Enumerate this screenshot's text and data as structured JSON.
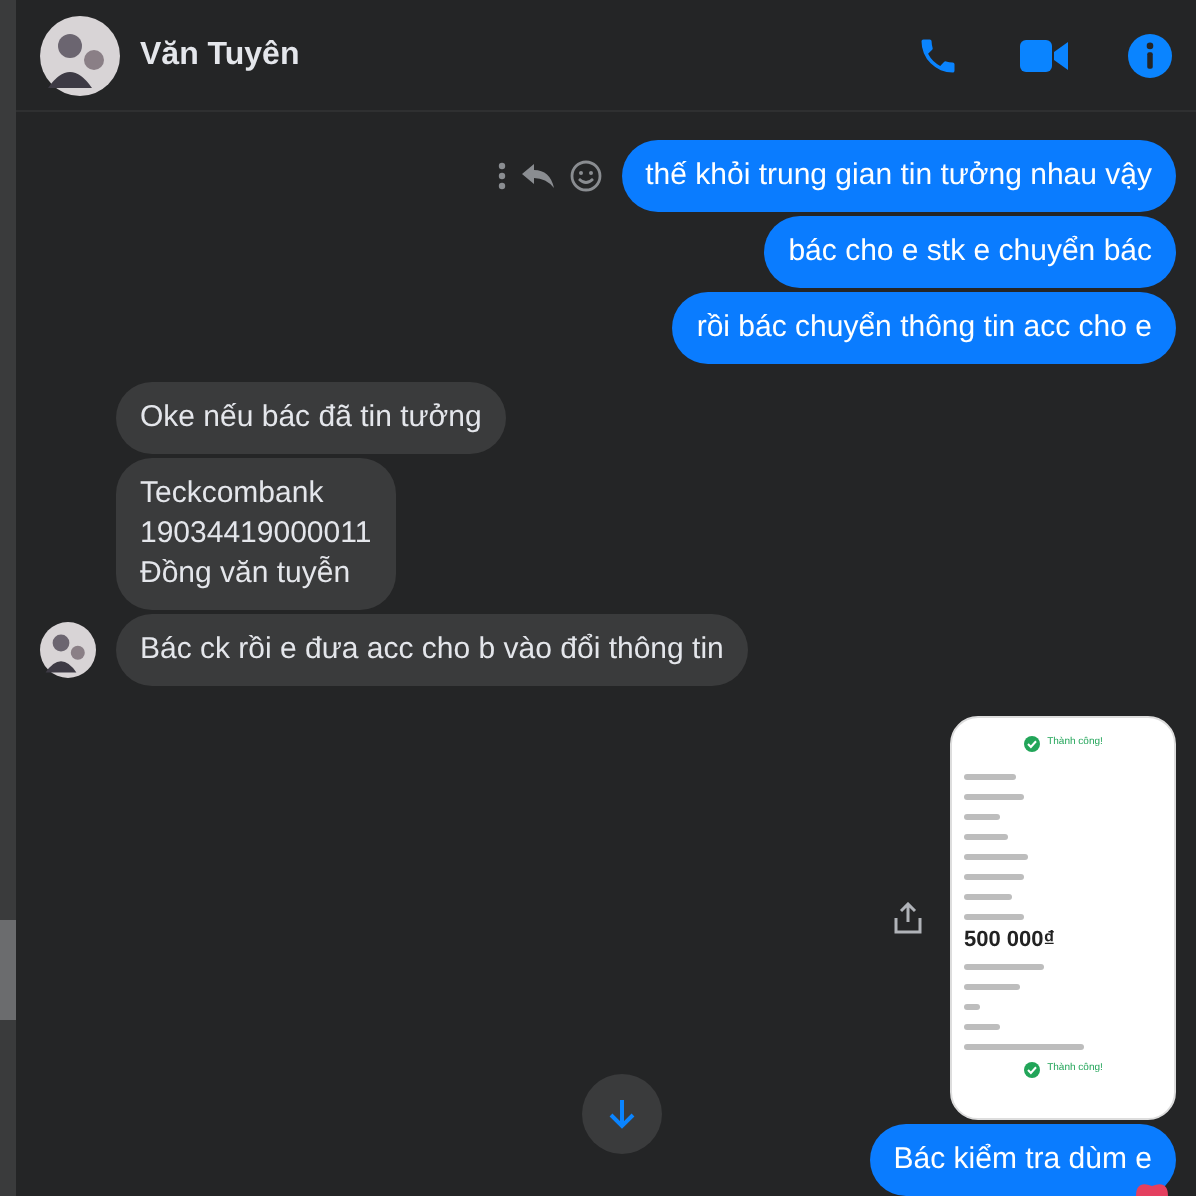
{
  "header": {
    "name": "Văn Tuyên"
  },
  "messages": [
    {
      "kind": "text",
      "outgoing": true,
      "text": "thế khỏi trung gian tin tưởng nhau vậy",
      "actions": true
    },
    {
      "kind": "text",
      "outgoing": true,
      "text": "bác cho e stk e chuyển bác"
    },
    {
      "kind": "text",
      "outgoing": true,
      "text": "rồi bác chuyển thông tin acc cho e"
    },
    {
      "kind": "text",
      "outgoing": false,
      "text": "Oke nếu bác đã tin tưởng"
    },
    {
      "kind": "text",
      "outgoing": false,
      "lines": [
        "Teckcombank",
        "19034419000011",
        "Đồng văn tuyễn"
      ]
    },
    {
      "kind": "text",
      "outgoing": false,
      "text": "Bác ck rồi e đưa acc cho b vào đổi thông tin",
      "avatar": true
    },
    {
      "kind": "image",
      "outgoing": true,
      "status": "Thành công!",
      "amount": "500 000₫",
      "footer": "Thành công!"
    },
    {
      "kind": "text",
      "outgoing": true,
      "text": "Bác kiểm tra dùm e",
      "reaction": true
    }
  ]
}
